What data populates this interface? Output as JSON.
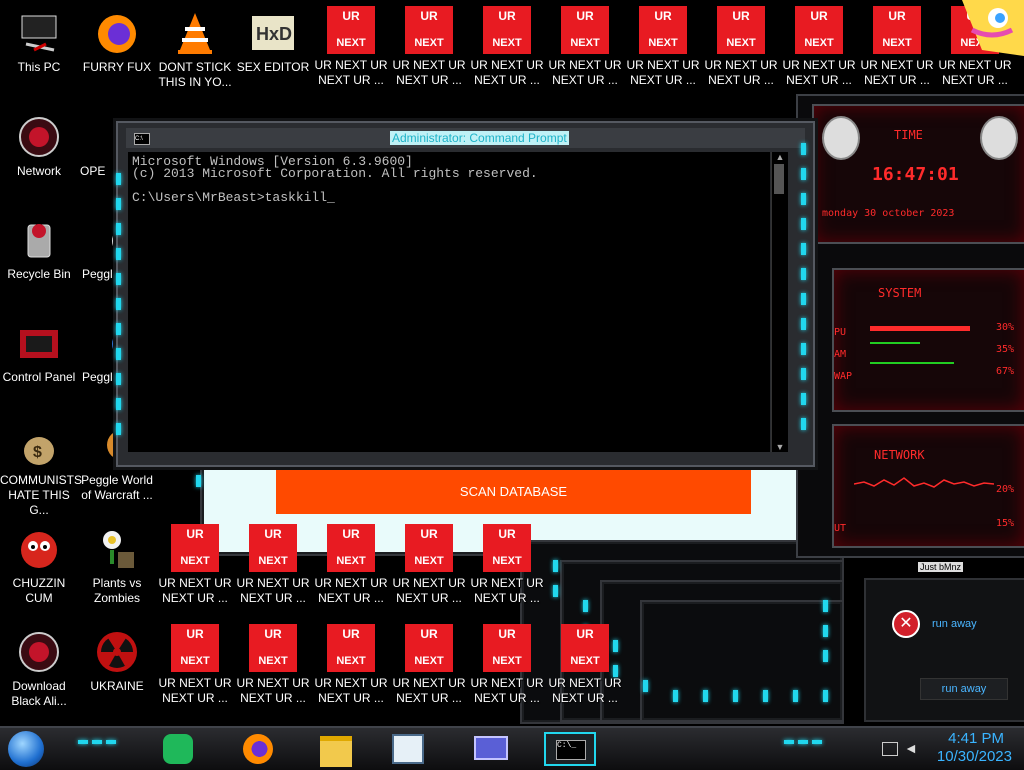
{
  "desktop_icons": [
    {
      "label": "This PC",
      "icon": "computer-icon"
    },
    {
      "label": "FURRY FUX",
      "icon": "firefox-icon"
    },
    {
      "label": "DONT STICK THIS IN YO...",
      "icon": "vlc-icon"
    },
    {
      "label": "SEX EDITOR",
      "icon": "hxd-icon"
    },
    {
      "label": "Network",
      "icon": "alien-network-icon"
    },
    {
      "label": "OPE",
      "icon": "open-icon"
    },
    {
      "label": "Recycle Bin",
      "icon": "recycle-bin-icon"
    },
    {
      "label": "Peggl",
      "icon": "peggle-icon"
    },
    {
      "label": "Control Panel",
      "icon": "control-panel-icon"
    },
    {
      "label": "Peggl",
      "icon": "peggle-icon"
    },
    {
      "label": "COMMUNISTS HATE THIS G...",
      "icon": "money-bag-icon"
    },
    {
      "label": "Peggle World of Warcraft ...",
      "icon": "peggle-wow-icon"
    },
    {
      "label": "CHUZZIN CUM",
      "icon": "chuzzle-icon"
    },
    {
      "label": "Plants vs Zombies",
      "icon": "plants-vs-zombies-icon"
    },
    {
      "label": "Download Black Ali...",
      "icon": "alien-download-icon"
    },
    {
      "label": "UKRAINE",
      "icon": "radiation-icon"
    }
  ],
  "ur_icon": {
    "top": "UR",
    "bottom": "NEXT",
    "label": "UR NEXT UR NEXT UR ..."
  },
  "cmd": {
    "title": "Administrator: Command Prompt",
    "lines": [
      "Microsoft Windows [Version 6.3.9600]",
      "(c) 2013 Microsoft Corporation. All rights reserved.",
      "",
      "C:\\Users\\MrBeast>taskkill_"
    ]
  },
  "scan_button": "SCAN DATABASE",
  "clock_widget": {
    "label": "TIME",
    "time": "16:47:01",
    "date": "monday 30 october 2023"
  },
  "system_widget": {
    "label": "SYSTEM",
    "rows": [
      {
        "k": "PU",
        "v": "30%"
      },
      {
        "k": "AM",
        "v": "35%"
      },
      {
        "k": "WAP",
        "v": "67%"
      }
    ]
  },
  "network_widget": {
    "label": "NETWORK",
    "rows": [
      {
        "k": "",
        "v": "20%"
      },
      {
        "k": "UT",
        "v": "15%"
      }
    ]
  },
  "side_panel": {
    "header": "Just bMnz",
    "error_text": "run away",
    "button": "run away"
  },
  "taskbar": {
    "time": "4:41 PM",
    "date": "10/30/2023",
    "apps": [
      "start-orb-icon",
      "chat-icon",
      "firefox-icon",
      "file-explorer-icon",
      "notepad-icon",
      "card-icon",
      "cmd-icon"
    ]
  },
  "colors": {
    "ur_red": "#e81b22",
    "scan_orange": "#ff4a00",
    "cyan_light": "#21d7ee",
    "clock_blue": "#3ab4ff"
  }
}
